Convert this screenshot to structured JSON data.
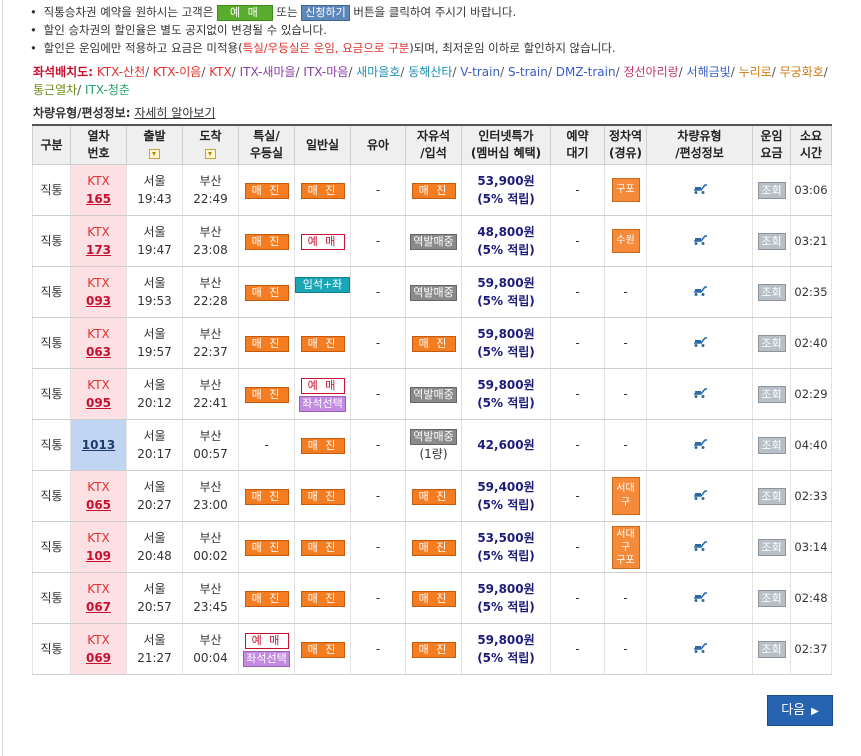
{
  "notices": {
    "n1": {
      "pre": "직통승차권 예약을 원하시는 고객은",
      "btn1": "예 매",
      "mid": "또는",
      "btn2": "신청하기",
      "post": "버튼을 클릭하여 주시기 바랍니다."
    },
    "n2": "할인 승차권의 할인율은 별도 공지없이 변경될 수 있습니다.",
    "n3": {
      "pre": "할인은 운임에만 적용하고 요금은 미적용(",
      "em": "특실/우등실은 운임, 요금으로 구분",
      "post": ")되며, 최저운임 이하로 할인하지 않습니다."
    }
  },
  "seat_layout": {
    "label": "좌석배치도:",
    "links": [
      {
        "text": "KTX-산천",
        "color": "#e0312d"
      },
      {
        "text": "KTX-이음",
        "color": "#e0312d"
      },
      {
        "text": "KTX",
        "color": "#e0312d"
      },
      {
        "text": "ITX-새마을",
        "color": "#8a3aa6"
      },
      {
        "text": "ITX-마음",
        "color": "#8a3aa6"
      },
      {
        "text": "새마을호",
        "color": "#1f8fb1"
      },
      {
        "text": "동해산타",
        "color": "#1f8fb1"
      },
      {
        "text": "V-train",
        "color": "#3a5cc8"
      },
      {
        "text": "S-train",
        "color": "#3a5cc8"
      },
      {
        "text": "DMZ-train",
        "color": "#3a5cc8"
      },
      {
        "text": "정선아리랑",
        "color": "#c0366f"
      },
      {
        "text": "서해금빛",
        "color": "#3a5cc8"
      },
      {
        "text": "누리로",
        "color": "#d07a10"
      },
      {
        "text": "무궁화호",
        "color": "#d07a10"
      },
      {
        "text": "통근열차",
        "color": "#6d8a1a"
      },
      {
        "text": "ITX-청춘",
        "color": "#27a26c"
      }
    ]
  },
  "car_info": {
    "label": "차량유형/편성정보:",
    "link": "자세히 알아보기"
  },
  "table": {
    "headers": {
      "type": "구분",
      "train_no": [
        "열차",
        "번호"
      ],
      "depart": "출발",
      "arrive": "도착",
      "special": [
        "특실/",
        "우등실"
      ],
      "general": "일반실",
      "infant": "유아",
      "free": [
        "자유석",
        "/입석"
      ],
      "internet": [
        "인터넷특가",
        "(멤버십 혜택)"
      ],
      "waitlist": [
        "예약",
        "대기"
      ],
      "stops": [
        "정차역",
        "(경유)"
      ],
      "car": [
        "차량유형",
        "/편성정보"
      ],
      "fare": [
        "운임",
        "요금"
      ],
      "duration": [
        "소요",
        "시간"
      ]
    },
    "rows": [
      {
        "type": "직통",
        "ktx": "KTX",
        "no": "165",
        "from": "서울",
        "dep": "19:43",
        "to": "부산",
        "arr": "22:49",
        "special": "매 진",
        "general": [
          "매 진"
        ],
        "infant": "-",
        "free": {
          "kind": "soldout",
          "text": "매 진"
        },
        "price": "53,900원",
        "points": "(5% 적립)",
        "wait": "-",
        "stops": [
          "구포"
        ],
        "fare": "조회",
        "dur": "03:06"
      },
      {
        "type": "직통",
        "ktx": "KTX",
        "no": "173",
        "from": "서울",
        "dep": "19:47",
        "to": "부산",
        "arr": "23:08",
        "special": "매 진",
        "general": [
          "예 매"
        ],
        "infant": "-",
        "free": {
          "kind": "station",
          "text": "역발매중"
        },
        "price": "48,800원",
        "points": "(5% 적립)",
        "wait": "-",
        "stops": [
          "수원"
        ],
        "fare": "조회",
        "dur": "03:21"
      },
      {
        "type": "직통",
        "ktx": "KTX",
        "no": "093",
        "from": "서울",
        "dep": "19:53",
        "to": "부산",
        "arr": "22:28",
        "special": "매 진",
        "general": [
          "입석+좌석"
        ],
        "infant": "-",
        "free": {
          "kind": "station",
          "text": "역발매중"
        },
        "price": "59,800원",
        "points": "(5% 적립)",
        "wait": "-",
        "stops": [],
        "fare": "조회",
        "dur": "02:35"
      },
      {
        "type": "직통",
        "ktx": "KTX",
        "no": "063",
        "from": "서울",
        "dep": "19:57",
        "to": "부산",
        "arr": "22:37",
        "special": "매 진",
        "general": [
          "매 진"
        ],
        "infant": "-",
        "free": {
          "kind": "soldout",
          "text": "매 진"
        },
        "price": "59,800원",
        "points": "(5% 적립)",
        "wait": "-",
        "stops": [],
        "fare": "조회",
        "dur": "02:40"
      },
      {
        "type": "직통",
        "ktx": "KTX",
        "no": "095",
        "from": "서울",
        "dep": "20:12",
        "to": "부산",
        "arr": "22:41",
        "special": "매 진",
        "general": [
          "예 매",
          "좌석선택"
        ],
        "infant": "-",
        "free": {
          "kind": "station",
          "text": "역발매중"
        },
        "price": "59,800원",
        "points": "(5% 적립)",
        "wait": "-",
        "stops": [],
        "fare": "조회",
        "dur": "02:29"
      },
      {
        "type": "직통",
        "ktx": "",
        "no": "1013",
        "from": "서울",
        "dep": "20:17",
        "to": "부산",
        "arr": "00:57",
        "special": "-",
        "general": [
          "매 진"
        ],
        "infant": "-",
        "free": {
          "kind": "station2",
          "text": "역발매중",
          "sub": "(1량)"
        },
        "price": "42,600원",
        "points": "",
        "wait": "-",
        "stops": [],
        "fare": "조회",
        "dur": "04:40"
      },
      {
        "type": "직통",
        "ktx": "KTX",
        "no": "065",
        "from": "서울",
        "dep": "20:27",
        "to": "부산",
        "arr": "23:00",
        "special": "매 진",
        "general": [
          "매 진"
        ],
        "infant": "-",
        "free": {
          "kind": "soldout",
          "text": "매 진"
        },
        "price": "59,400원",
        "points": "(5% 적립)",
        "wait": "-",
        "stops": [
          "서대구"
        ],
        "fare": "조회",
        "dur": "02:33"
      },
      {
        "type": "직통",
        "ktx": "KTX",
        "no": "109",
        "from": "서울",
        "dep": "20:48",
        "to": "부산",
        "arr": "00:02",
        "special": "매 진",
        "general": [
          "매 진"
        ],
        "infant": "-",
        "free": {
          "kind": "soldout",
          "text": "매 진"
        },
        "price": "53,500원",
        "points": "(5% 적립)",
        "wait": "-",
        "stops": [
          "서대구",
          "구포"
        ],
        "fare": "조회",
        "dur": "03:14"
      },
      {
        "type": "직통",
        "ktx": "KTX",
        "no": "067",
        "from": "서울",
        "dep": "20:57",
        "to": "부산",
        "arr": "23:45",
        "special": "매 진",
        "general": [
          "매 진"
        ],
        "infant": "-",
        "free": {
          "kind": "soldout",
          "text": "매 진"
        },
        "price": "59,800원",
        "points": "(5% 적립)",
        "wait": "-",
        "stops": [],
        "fare": "조회",
        "dur": "02:48"
      },
      {
        "type": "직통",
        "ktx": "KTX",
        "no": "069",
        "from": "서울",
        "dep": "21:27",
        "to": "부산",
        "arr": "00:04",
        "special": [
          "예 매",
          "좌석선택"
        ],
        "general": [
          "매 진"
        ],
        "infant": "-",
        "free": {
          "kind": "soldout",
          "text": "매 진"
        },
        "price": "59,800원",
        "points": "(5% 적립)",
        "wait": "-",
        "stops": [],
        "fare": "조회",
        "dur": "02:37"
      }
    ]
  },
  "next_button": {
    "label": "다음",
    "arrow": "▶"
  },
  "colors": {
    "soldout": "#f57d21",
    "reserve_border": "#c8102e",
    "standing": "#1ba6b6",
    "seat_select": "#c28be0",
    "station": "#8a8a8a",
    "stop_box": "#f58a3a",
    "next_button": "#2663b0",
    "train_cell": "#fde0e4",
    "train_cell_alt": "#bfd5f2"
  }
}
